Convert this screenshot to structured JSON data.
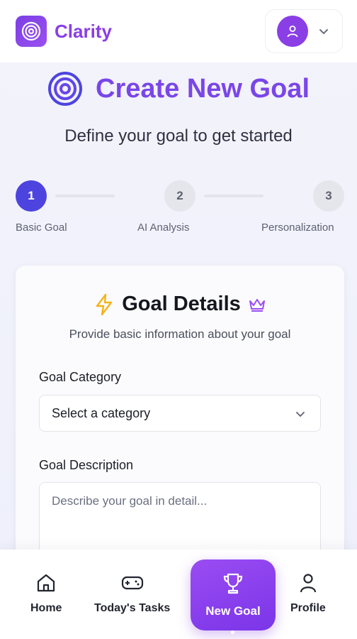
{
  "header": {
    "app_name": "Clarity",
    "logo_icon": "target-icon",
    "profile_icon": "user-icon",
    "menu_icon": "chevron-down-icon"
  },
  "page": {
    "title": "Create New Goal",
    "subtitle": "Define your goal to get started"
  },
  "stepper": {
    "steps": [
      {
        "number": "1",
        "label": "Basic Goal",
        "state": "active"
      },
      {
        "number": "2",
        "label": "AI Analysis",
        "state": "inactive"
      },
      {
        "number": "3",
        "label": "Personalization",
        "state": "inactive"
      }
    ]
  },
  "card": {
    "title": "Goal Details",
    "subtitle": "Provide basic information about your goal",
    "category_label": "Goal Category",
    "category_value": "Select a category",
    "description_label": "Goal Description",
    "description_placeholder": "Describe your goal in detail..."
  },
  "bottom_nav": {
    "items": [
      {
        "label": "Home",
        "icon": "home-icon"
      },
      {
        "label": "Today's Tasks",
        "icon": "gamepad-icon"
      },
      {
        "label": "New Goal",
        "icon": "trophy-icon",
        "active": true
      },
      {
        "label": "Profile",
        "icon": "user-icon"
      }
    ]
  },
  "colors": {
    "brand": "#8a3ee6",
    "step_active": "#4d44e0",
    "bolt": "#f2b418",
    "crown": "#9a4cf2"
  }
}
